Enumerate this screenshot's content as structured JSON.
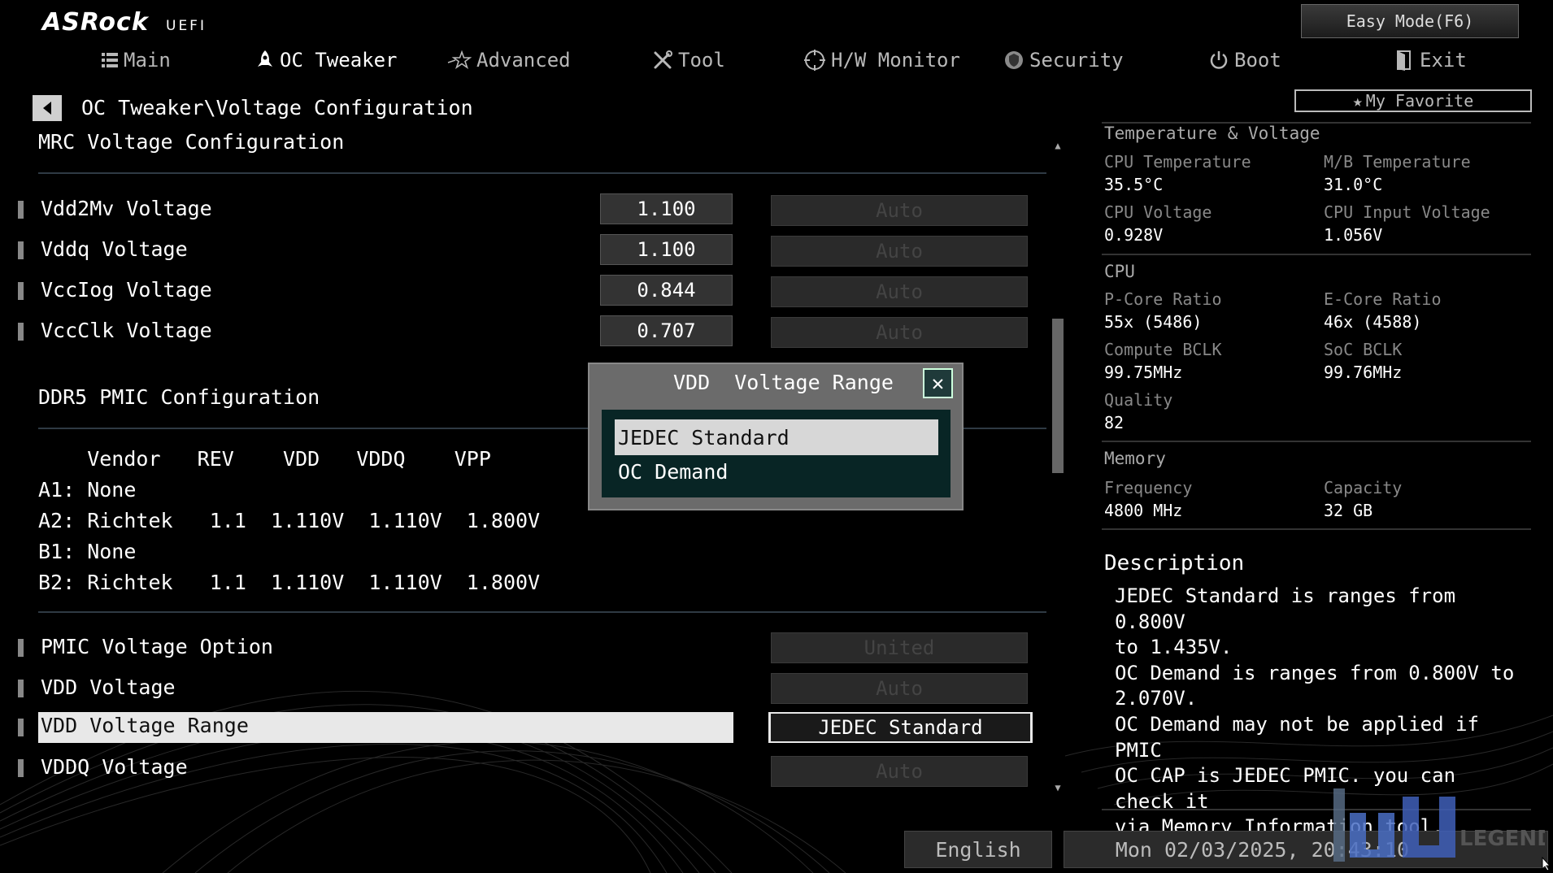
{
  "header": {
    "brand": "ASRock",
    "brand_sub": "UEFI",
    "easy_mode": "Easy Mode(F6)",
    "my_favorite": "My Favorite"
  },
  "nav": [
    {
      "label": "Main",
      "icon": "list-icon"
    },
    {
      "label": "OC Tweaker",
      "icon": "rocket-icon",
      "active": true
    },
    {
      "label": "Advanced",
      "icon": "star-icon"
    },
    {
      "label": "Tool",
      "icon": "tools-icon"
    },
    {
      "label": "H/W Monitor",
      "icon": "monitor-icon"
    },
    {
      "label": "Security",
      "icon": "shield-icon"
    },
    {
      "label": "Boot",
      "icon": "power-icon"
    },
    {
      "label": "Exit",
      "icon": "exit-icon"
    }
  ],
  "breadcrumb": "OC Tweaker\\Voltage Configuration",
  "sections": {
    "mrc": "MRC Voltage Configuration",
    "pmic": "DDR5 PMIC Configuration"
  },
  "voltage_rows": [
    {
      "label": "Vdd2Mv Voltage",
      "value": "1.100",
      "mode": "Auto"
    },
    {
      "label": "Vddq Voltage",
      "value": "1.100",
      "mode": "Auto"
    },
    {
      "label": "VccIog Voltage",
      "value": "0.844",
      "mode": "Auto"
    },
    {
      "label": "VccClk Voltage",
      "value": "0.707",
      "mode": "Auto"
    }
  ],
  "pmic_table": {
    "header": "    Vendor   REV    VDD   VDDQ    VPP",
    "rows": [
      "A1: None",
      "A2: Richtek   1.1  1.110V  1.110V  1.800V",
      "B1: None",
      "B2: Richtek   1.1  1.110V  1.110V  1.800V"
    ]
  },
  "option_rows": [
    {
      "label": "PMIC Voltage Option",
      "value": "United"
    },
    {
      "label": "VDD  Voltage",
      "value": "Auto"
    },
    {
      "label": "VDD  Voltage Range",
      "value": "JEDEC Standard",
      "selected": true
    },
    {
      "label": "VDDQ Voltage",
      "value": "Auto"
    }
  ],
  "popup": {
    "title": "VDD  Voltage Range",
    "options": [
      "JEDEC Standard",
      "OC Demand"
    ],
    "selected": "JEDEC Standard"
  },
  "right_panel": {
    "temp_heading": "Temperature & Voltage",
    "cpu_temp_label": "CPU Temperature",
    "cpu_temp": "35.5°C",
    "mb_temp_label": "M/B Temperature",
    "mb_temp": "31.0°C",
    "cpu_volt_label": "CPU Voltage",
    "cpu_volt": "0.928V",
    "cpu_in_label": "CPU Input Voltage",
    "cpu_in": "1.056V",
    "cpu_heading": "CPU",
    "pcore_label": "P-Core Ratio",
    "pcore": "55x (5486)",
    "ecore_label": "E-Core Ratio",
    "ecore": "46x (4588)",
    "cbclk_label": "Compute BCLK",
    "cbclk": "99.75MHz",
    "socbclk_label": "SoC BCLK",
    "socbclk": "99.76MHz",
    "quality_label": "Quality",
    "quality": "82",
    "mem_heading": "Memory",
    "freq_label": "Frequency",
    "freq": "4800 MHz",
    "cap_label": "Capacity",
    "cap": "32 GB"
  },
  "description": {
    "title": "Description",
    "text": "JEDEC Standard is ranges from 0.800V\nto 1.435V.\nOC Demand is ranges from 0.800V to\n2.070V.\nOC Demand may not be applied if PMIC\nOC CAP is JEDEC PMIC. you can check it\nvia Memory Information tool."
  },
  "status_bar": {
    "language": "English",
    "datetime": "Mon 02/03/2025, 20:43:10"
  },
  "watermark": "LEGEND",
  "colors": {
    "background": "#000000",
    "popup_list_bg": "#082525",
    "highlight": "#e8e8e8"
  }
}
